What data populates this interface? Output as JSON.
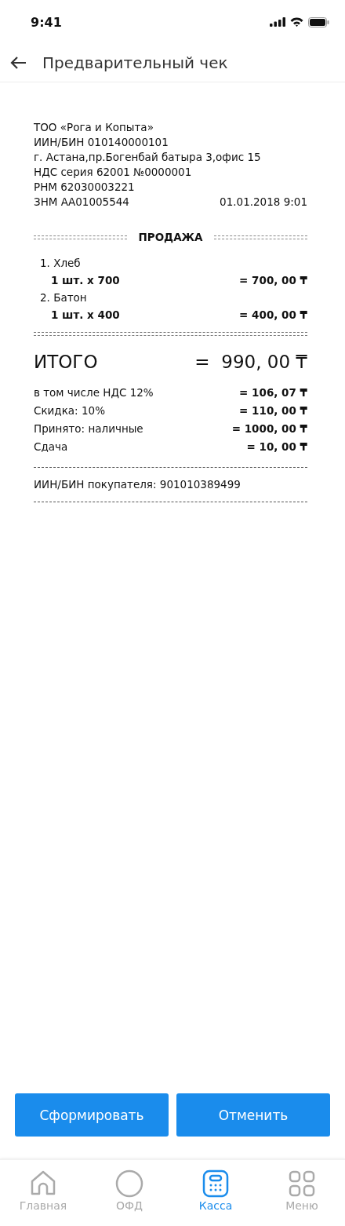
{
  "status_bar": {
    "time": "9:41"
  },
  "header": {
    "title": "Предварительный чек"
  },
  "receipt": {
    "seller_lines": [
      "ТОО «Рога и Копыта»",
      "ИИН/БИН 010140000101",
      "г. Астана,пр.Богенбай батыра 3,офис 15",
      "НДС серия 62001 №0000001",
      "РНМ 62030003221",
      "ЗНМ АА01005544"
    ],
    "datetime": "01.01.2018 9:01",
    "section_title": "ПРОДАЖА",
    "items": [
      {
        "name": "1. Хлеб",
        "quantity": "1 шт. x 700",
        "amount": "= 700, 00 ₸"
      },
      {
        "name": "2. Батон",
        "quantity": "1 шт. x 400",
        "amount": "= 400, 00 ₸"
      }
    ],
    "total": {
      "label": "ИТОГО",
      "value": "=  990, 00 ₸"
    },
    "details": [
      {
        "label": "в том числе НДС 12%",
        "value": "= 106, 07 ₸"
      },
      {
        "label": "Скидка: 10%",
        "value": "= 110, 00 ₸"
      },
      {
        "label": "Принято: наличные",
        "value": "= 1000, 00 ₸"
      },
      {
        "label": "Сдача",
        "value": "= 10, 00 ₸"
      }
    ],
    "buyer": "ИИН/БИН покупателя: 901010389499"
  },
  "buttons": [
    "Сформировать",
    "Отменить"
  ],
  "tab_bar": [
    {
      "label": "Главная",
      "kind": "home",
      "selected": false
    },
    {
      "label": "ОФД",
      "kind": "circle",
      "selected": false
    },
    {
      "label": "Касса",
      "kind": "calculator",
      "selected": true
    },
    {
      "label": "Меню",
      "kind": "grid",
      "selected": false
    }
  ]
}
